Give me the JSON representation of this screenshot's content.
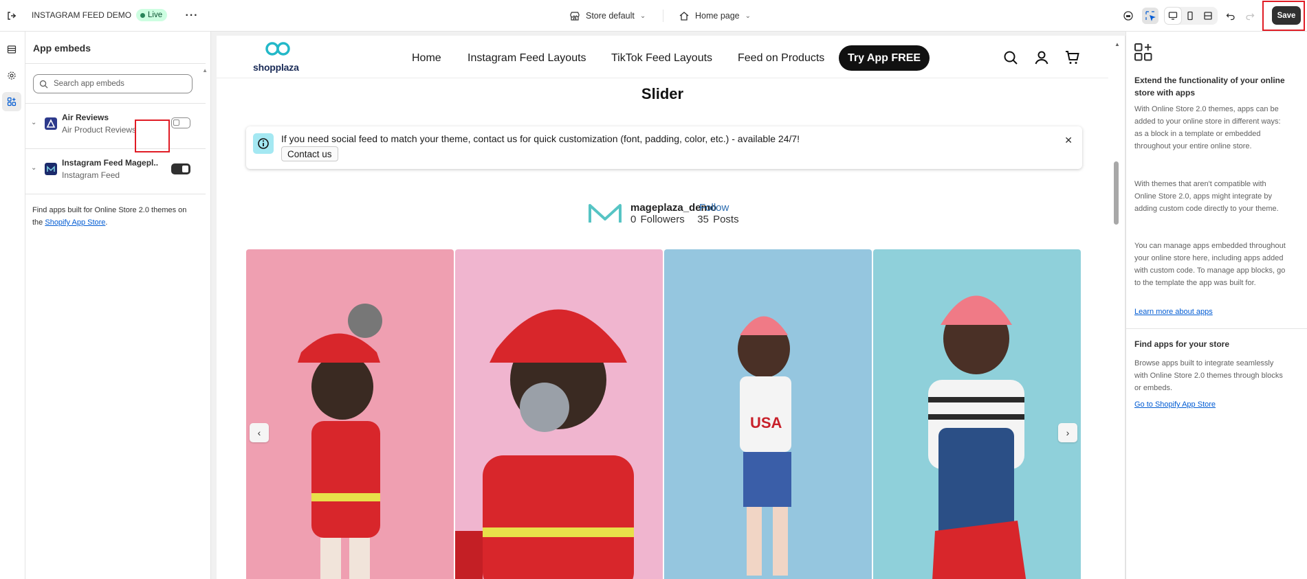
{
  "topbar": {
    "store_title": "INSTAGRAM FEED DEMO",
    "status_badge": "Live",
    "theme_selector": "Store default",
    "page_selector": "Home page",
    "save_label": "Save"
  },
  "sidebar": {
    "title": "App embeds",
    "search_placeholder": "Search app embeds",
    "apps": [
      {
        "name": "Air Reviews",
        "subtitle": "Air Product Reviews",
        "enabled": false
      },
      {
        "name": "Instagram Feed Magepl...",
        "subtitle": "Instagram Feed",
        "enabled": true
      }
    ],
    "find_text": "Find apps built for Online Store 2.0 themes on the",
    "find_link": "Shopify App Store",
    "find_suffix": "."
  },
  "preview": {
    "brand": "shopplaza",
    "nav_links": [
      "Home",
      "Instagram Feed Layouts",
      "TikTok Feed Layouts",
      "Feed on Products"
    ],
    "nav_cta": "Try App FREE",
    "section_title": "Slider",
    "notice_message": "If you need social feed to match your theme, contact us for quick customization (font, padding, color, etc.) - available 24/7!",
    "notice_button": "Contact us",
    "profile": {
      "username": "mageplaza_demo",
      "follow_label": "Follow",
      "followers": "0 Followers",
      "posts": "35 Posts"
    },
    "gallery_colors": [
      "#ef9fb1",
      "#f0b5cf",
      "#95c6df",
      "#8fd0da"
    ]
  },
  "right_panel": {
    "heading": "Extend the functionality of your online store with apps",
    "para1": "With Online Store 2.0 themes, apps can be added to your online store in different ways: as a block in a template or embedded throughout your entire online store.",
    "para2": "With themes that aren't compatible with Online Store 2.0, apps might integrate by adding custom code directly to your theme.",
    "para3": "You can manage apps embedded throughout your online store here, including apps added with custom code. To manage app blocks, go to the template the app was built for.",
    "link1": "Learn more about apps",
    "heading2": "Find apps for your store",
    "para4": "Browse apps built to integrate seamlessly with Online Store 2.0 themes through blocks or embeds.",
    "link2": "Go to Shopify App Store"
  }
}
